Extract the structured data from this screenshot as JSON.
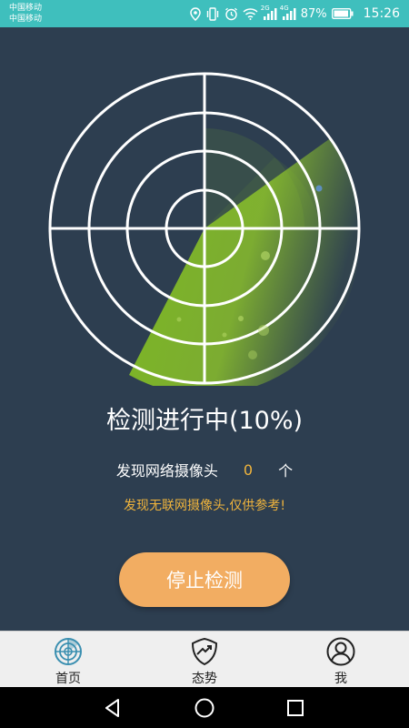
{
  "status_bar": {
    "carrier_1": "中国移动",
    "carrier_2": "中国移动",
    "network_1": "2G",
    "network_2": "4G",
    "battery": "87%",
    "time": "15:26",
    "icons": [
      "location-icon",
      "vibrate-icon",
      "alarm-icon",
      "wifi-icon",
      "signal-icon",
      "battery-icon"
    ]
  },
  "scan": {
    "title": "检测进行中(10%)",
    "progress_percent": 10,
    "found_label": "发现网络摄像头",
    "found_count": "0",
    "found_unit": "个",
    "note": "发现无联网摄像头,仅供参考!",
    "stop_button": "停止检测"
  },
  "tabs": [
    {
      "label": "首页",
      "icon": "radar-icon",
      "active": true
    },
    {
      "label": "态势",
      "icon": "shield-trend-icon",
      "active": false
    },
    {
      "label": "我",
      "icon": "user-icon",
      "active": false
    }
  ],
  "colors": {
    "status_bar": "#3fbfbd",
    "background": "#2d3e50",
    "accent_orange": "#f0b43c",
    "button": "#f2ad62",
    "sweep_green": "#8fc62a",
    "tab_active": "#3a8fb0"
  }
}
